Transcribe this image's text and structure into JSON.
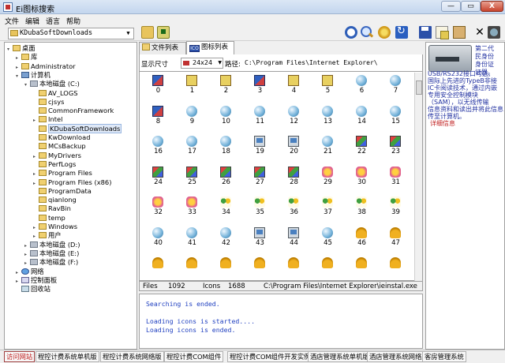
{
  "window": {
    "title": "Ei图标搜索",
    "min_label": "—",
    "max_label": "▭",
    "close_label": "X"
  },
  "menu": [
    "文件",
    "编辑",
    "语言",
    "帮助"
  ],
  "toolbar": {
    "path_value": "KDubaSoftDownloads",
    "icons": [
      "folder-open-icon",
      "folder-up-icon",
      "circle-icon",
      "magnifier-icon",
      "gear-icon",
      "refresh-icon",
      "save-icon",
      "copy-icon",
      "paste-icon",
      "close-x-icon",
      "help-icon"
    ]
  },
  "tree": [
    {
      "label": "桌面",
      "icon": "desktop",
      "level": 0,
      "expander": "▾"
    },
    {
      "label": "库",
      "icon": "folder",
      "level": 1,
      "expander": "▸"
    },
    {
      "label": "Administrator",
      "icon": "folder",
      "level": 1,
      "expander": "▸"
    },
    {
      "label": "计算机",
      "icon": "pc",
      "level": 1,
      "expander": "▾"
    },
    {
      "label": "本地磁盘 (C:)",
      "icon": "drive",
      "level": 2,
      "expander": "▾"
    },
    {
      "label": "AV_LOGS",
      "icon": "folder",
      "level": 3,
      "expander": ""
    },
    {
      "label": "cjsys",
      "icon": "folder",
      "level": 3,
      "expander": ""
    },
    {
      "label": "CommonFramework",
      "icon": "folder",
      "level": 3,
      "expander": ""
    },
    {
      "label": "Intel",
      "icon": "folder",
      "level": 3,
      "expander": "▸"
    },
    {
      "label": "KDubaSoftDownloads",
      "icon": "folder",
      "level": 3,
      "expander": "",
      "selected": true
    },
    {
      "label": "KwDownload",
      "icon": "folder",
      "level": 3,
      "expander": ""
    },
    {
      "label": "MCsBackup",
      "icon": "folder",
      "level": 3,
      "expander": ""
    },
    {
      "label": "MyDrivers",
      "icon": "folder",
      "level": 3,
      "expander": "▸"
    },
    {
      "label": "PerfLogs",
      "icon": "folder",
      "level": 3,
      "expander": ""
    },
    {
      "label": "Program Files",
      "icon": "folder",
      "level": 3,
      "expander": "▸"
    },
    {
      "label": "Program Files (x86)",
      "icon": "folder",
      "level": 3,
      "expander": "▸"
    },
    {
      "label": "ProgramData",
      "icon": "folder",
      "level": 3,
      "expander": ""
    },
    {
      "label": "qianlong",
      "icon": "folder",
      "level": 3,
      "expander": ""
    },
    {
      "label": "RavBin",
      "icon": "folder",
      "level": 3,
      "expander": ""
    },
    {
      "label": "temp",
      "icon": "folder",
      "level": 3,
      "expander": ""
    },
    {
      "label": "Windows",
      "icon": "folder",
      "level": 3,
      "expander": "▸"
    },
    {
      "label": "用户",
      "icon": "folder",
      "level": 3,
      "expander": "▸"
    },
    {
      "label": "本地磁盘 (D:)",
      "icon": "drive",
      "level": 2,
      "expander": "▸"
    },
    {
      "label": "本地磁盘 (E:)",
      "icon": "drive",
      "level": 2,
      "expander": "▸"
    },
    {
      "label": "本地磁盘 (F:)",
      "icon": "drive",
      "level": 2,
      "expander": "▸"
    },
    {
      "label": "网络",
      "icon": "net",
      "level": 1,
      "expander": "▸"
    },
    {
      "label": "控制面板",
      "icon": "cp",
      "level": 1,
      "expander": "▸"
    },
    {
      "label": "回收站",
      "icon": "bin",
      "level": 1,
      "expander": ""
    }
  ],
  "tabs": [
    "文件列表",
    "图标列表"
  ],
  "tab_icon_text": "ICO",
  "options": {
    "size_label": "显示尺寸",
    "size_value": "24x24",
    "path_label": "路径:",
    "path_value": "C:\\Program Files\\Internet Explorer\\"
  },
  "icons": [
    "app",
    "doc",
    "doc",
    "app",
    "doc",
    "doc",
    "globe",
    "globe",
    "app",
    "globe",
    "globe",
    "globe",
    "globe",
    "globe",
    "globe",
    "globe",
    "globe",
    "globe",
    "globe",
    "monitor",
    "monitor",
    "globe",
    "cube",
    "cube",
    "cube",
    "cube",
    "cube",
    "cube",
    "cube",
    "star",
    "star",
    "star",
    "star",
    "star",
    "people",
    "people",
    "people",
    "people",
    "people",
    "people",
    "globe",
    "globe",
    "globe",
    "monitor",
    "monitor",
    "globe",
    "bell",
    "bell",
    "bell",
    "bell",
    "bell",
    "bell",
    "bell",
    "bell",
    "bell",
    "bell"
  ],
  "icon_numbers": [
    "0",
    "1",
    "2",
    "3",
    "4",
    "5",
    "6",
    "7",
    "8",
    "9",
    "10",
    "11",
    "12",
    "13",
    "14",
    "15",
    "16",
    "17",
    "18",
    "19",
    "20",
    "21",
    "22",
    "23",
    "24",
    "25",
    "26",
    "27",
    "28",
    "29",
    "30",
    "31",
    "32",
    "33",
    "34",
    "35",
    "36",
    "37",
    "38",
    "39",
    "40",
    "41",
    "42",
    "43",
    "44",
    "45",
    "46",
    "47",
    "",
    "",
    "",
    "",
    "",
    "",
    "",
    ""
  ],
  "status": {
    "files_label": "Files",
    "files_count": "1092",
    "icons_label": "Icons",
    "icons_count": "1688",
    "file_path": "C:\\Program Files\\Internet Explorer\\ieinstal.exe"
  },
  "log": [
    "Searching is ended.",
    "",
    "Loading icons is started....",
    "Loading icons is ended."
  ],
  "ad": {
    "lines_right": [
      "第二代",
      "民身份",
      "身份证",
      "证器。"
    ],
    "lines_full": [
      "USB/RS232接口可选,",
      "国际上先进的TypeB非接",
      "IC卡阅读技术，通过内嵌",
      "专用安全控制模块",
      "（SAM），以无线传输",
      "信息资料和读出并将此信息",
      "传至计算机。"
    ],
    "more_label": "详细信息"
  },
  "footer": [
    "访问网站",
    "程控计费系统单机版",
    "程控计费系统网络版",
    "程控计费COM组件",
    "程控计费COM组件开发实例",
    "酒店管理系统单机版",
    "酒店管理系统网络版",
    "客房管理系统"
  ]
}
